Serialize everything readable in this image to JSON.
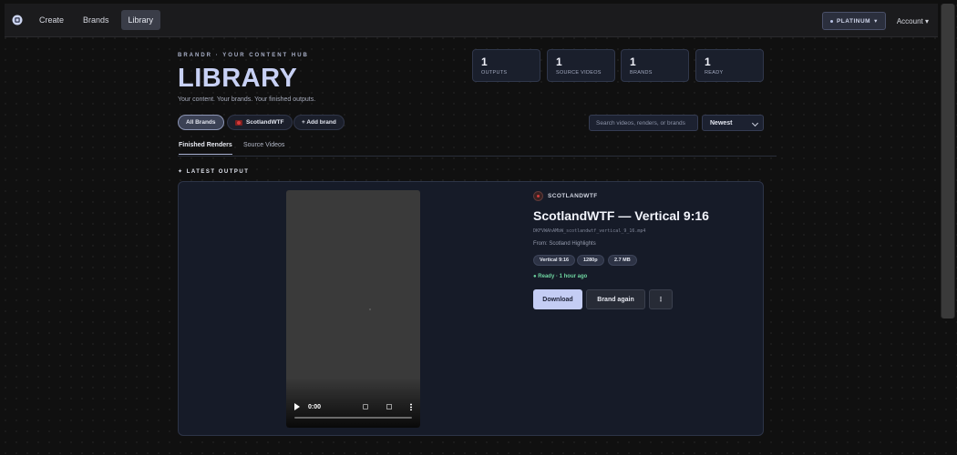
{
  "topbar": {
    "nav": [
      {
        "label": "Create"
      },
      {
        "label": "Brands"
      },
      {
        "label": "Library",
        "active": true
      }
    ],
    "plan_badge": "PLATINUM",
    "account_label": "Account ▾",
    "logo_icon": "brandr-logo-icon"
  },
  "header": {
    "eyebrow": "BRANDR · YOUR CONTENT HUB",
    "title": "LIBRARY",
    "subtitle": "Your content. Your brands. Your finished outputs."
  },
  "stats": [
    {
      "value": "1",
      "label": "OUTPUTS"
    },
    {
      "value": "1",
      "label": "SOURCE VIDEOS"
    },
    {
      "value": "1",
      "label": "BRANDS"
    },
    {
      "value": "1",
      "label": "READY"
    }
  ],
  "filters": {
    "chips": [
      {
        "label": "All Brands",
        "active": true
      },
      {
        "label": "ScotlandWTF"
      },
      {
        "label": "+ Add brand"
      }
    ],
    "search_placeholder": "Search videos, renders, or brands",
    "sort_value": "Newest"
  },
  "tabs": [
    {
      "label": "Finished Renders",
      "active": true
    },
    {
      "label": "Source Videos"
    }
  ],
  "section_label": "✦ LATEST OUTPUT",
  "latest": {
    "brand": "SCOTLANDWTF",
    "title": "ScotlandWTF — Vertical 9:16",
    "file_name": "DKFVWAhAMbW_scotlandwtf_vertical_9_16.mp4",
    "source": "From: Scotland Highlights",
    "tags": [
      "Vertical 9:16",
      "1280p",
      "2.7 MB"
    ],
    "status": "● Ready · 1 hour ago",
    "video_time": "0:00",
    "progress": 0,
    "buttons": {
      "download": "Download",
      "brand_again": "Brand again",
      "more": "⋮"
    }
  },
  "colors": {
    "accent": "#c4cdf4",
    "ready": "#6ed4a0",
    "background": "#101010"
  }
}
